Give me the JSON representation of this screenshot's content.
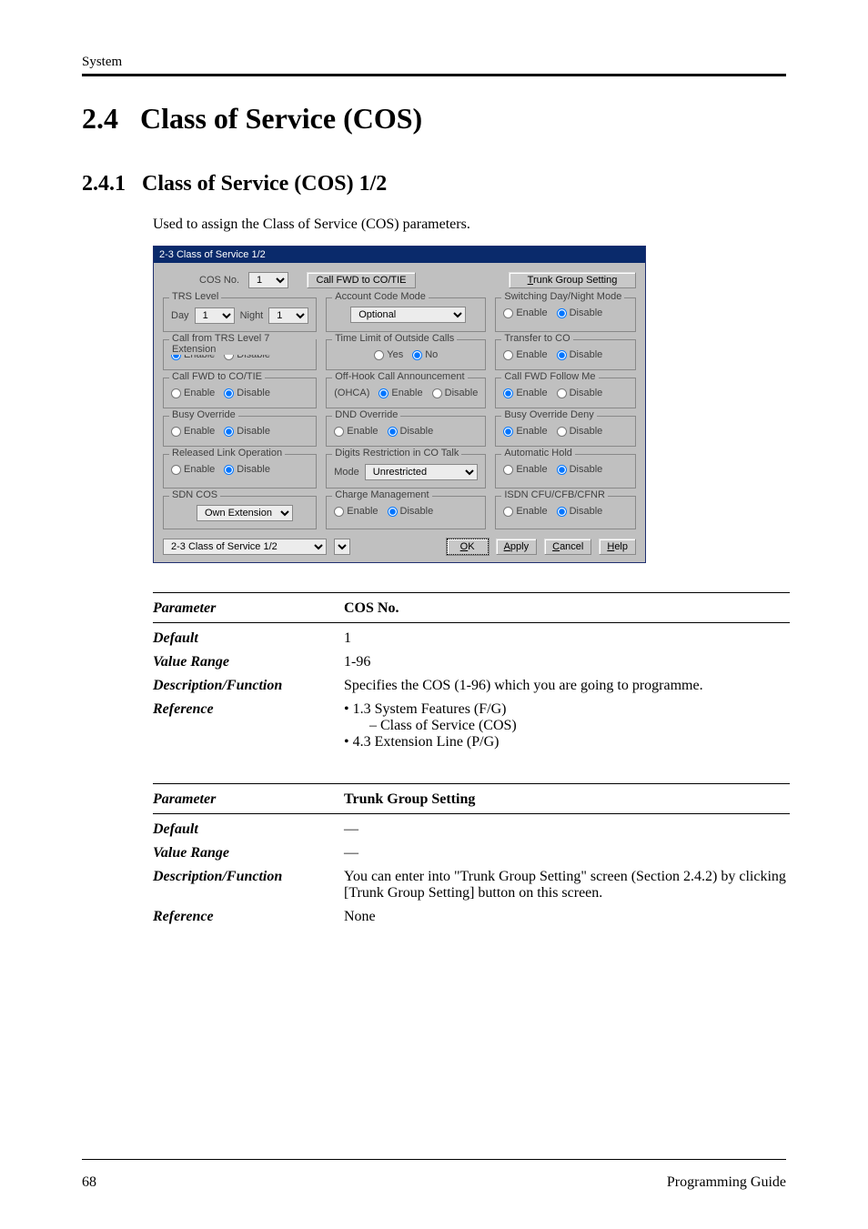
{
  "header": {
    "section": "System"
  },
  "headings": {
    "h1_number": "2.4",
    "h1_title": "Class of Service (COS)",
    "h2_number": "2.4.1",
    "h2_title": "Class of Service (COS) 1/2",
    "intro": "Used to assign the Class of Service (COS) parameters."
  },
  "dialog": {
    "title": "2-3 Class of Service 1/2",
    "top": {
      "cos_no_label": "COS No.",
      "cos_no_value": "1",
      "call_fwd_btn": "Call FWD to CO/TIE",
      "trunk_group_btn": "Trunk Group Setting"
    },
    "groups": {
      "trs_level": {
        "title": "TRS Level",
        "day_label": "Day",
        "day_value": "1",
        "night_label": "Night",
        "night_value": "1"
      },
      "account_code": {
        "title": "Account Code Mode",
        "value": "Optional"
      },
      "switching_daynight": {
        "title": "Switching Day/Night Mode",
        "enable": "Enable",
        "disable": "Disable",
        "selected": "disable"
      },
      "call_from_trs7": {
        "title": "Call from TRS Level 7 Extension",
        "enable": "Enable",
        "disable": "Disable",
        "selected": "enable"
      },
      "time_limit": {
        "title": "Time Limit of Outside Calls",
        "yes": "Yes",
        "no": "No",
        "selected": "no"
      },
      "transfer_co": {
        "title": "Transfer to CO",
        "enable": "Enable",
        "disable": "Disable",
        "selected": "disable"
      },
      "call_fwd_cotie": {
        "title": "Call FWD to CO/TIE",
        "enable": "Enable",
        "disable": "Disable",
        "selected": "disable"
      },
      "offhook": {
        "title": "Off-Hook Call Announcement",
        "prefix": "(OHCA)",
        "enable": "Enable",
        "disable": "Disable",
        "selected": "enable"
      },
      "fwd_follow": {
        "title": "Call FWD Follow Me",
        "enable": "Enable",
        "disable": "Disable",
        "selected": "enable"
      },
      "busy_override": {
        "title": "Busy Override",
        "enable": "Enable",
        "disable": "Disable",
        "selected": "disable"
      },
      "dnd_override": {
        "title": "DND Override",
        "enable": "Enable",
        "disable": "Disable",
        "selected": "disable"
      },
      "busy_override_deny": {
        "title": "Busy Override Deny",
        "enable": "Enable",
        "disable": "Disable",
        "selected": "enable"
      },
      "released_link": {
        "title": "Released Link Operation",
        "enable": "Enable",
        "disable": "Disable",
        "selected": "disable"
      },
      "digits_restrict": {
        "title": "Digits Restriction in CO Talk",
        "mode_label": "Mode",
        "value": "Unrestricted"
      },
      "auto_hold": {
        "title": "Automatic Hold",
        "enable": "Enable",
        "disable": "Disable",
        "selected": "disable"
      },
      "sdn_cos": {
        "title": "SDN COS",
        "value": "Own Extension"
      },
      "charge_mgmt": {
        "title": "Charge Management",
        "enable": "Enable",
        "disable": "Disable",
        "selected": "disable"
      },
      "isdn": {
        "title": "ISDN CFU/CFB/CFNR",
        "enable": "Enable",
        "disable": "Disable",
        "selected": "disable"
      }
    },
    "footer": {
      "nav_value": "2-3 Class of Service 1/2",
      "ok": "OK",
      "apply": "Apply",
      "cancel": "Cancel",
      "help": "Help"
    }
  },
  "params": [
    {
      "title_key": "Parameter",
      "title_val": "COS No.",
      "rows": [
        {
          "k": "Default",
          "v": "1"
        },
        {
          "k": "Value Range",
          "v": "1-96"
        },
        {
          "k": "Description/Function",
          "v": "Specifies the COS (1-96) which you are going to programme."
        },
        {
          "k": "Reference",
          "bullets": [
            "1.3 System Features (F/G)",
            "– Class of Service (COS)",
            "4.3   Extension Line (P/G)"
          ],
          "bullet_types": [
            "dot",
            "indent",
            "dot"
          ]
        }
      ]
    },
    {
      "title_key": "Parameter",
      "title_val": "Trunk Group Setting",
      "rows": [
        {
          "k": "Default",
          "v": "—"
        },
        {
          "k": "Value Range",
          "v": "—"
        },
        {
          "k": "Description/Function",
          "v": "You can enter into \"Trunk Group Setting\" screen (Section 2.4.2) by clicking [Trunk Group Setting] button on this screen."
        },
        {
          "k": "Reference",
          "v": "None"
        }
      ]
    }
  ],
  "page_footer": {
    "page_number": "68",
    "doc_title": "Programming Guide"
  }
}
